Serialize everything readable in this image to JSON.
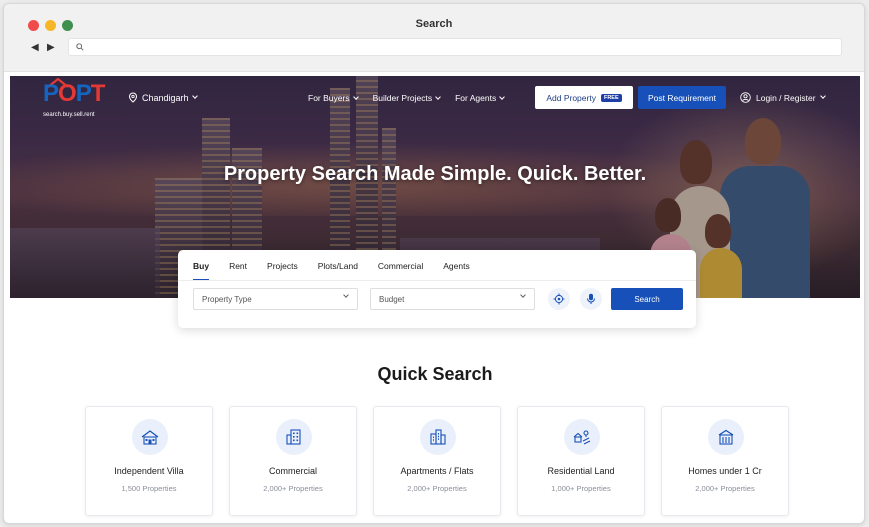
{
  "window": {
    "title": "Search"
  },
  "brand": {
    "logo_letters": [
      "P",
      "O",
      "P",
      "T"
    ],
    "tagline": "search.buy.sell.rent",
    "primary": "#1650b8",
    "accent": "#e53935"
  },
  "header": {
    "city": "Chandigarh",
    "nav": [
      {
        "label": "For Buyers"
      },
      {
        "label": "Builder Projects"
      },
      {
        "label": "For Agents"
      }
    ],
    "add_property": {
      "label": "Add Property",
      "badge": "FREE"
    },
    "post_requirement": "Post Requirement",
    "login": "Login / Register"
  },
  "hero": {
    "title": "Property Search Made Simple. Quick. Better."
  },
  "search": {
    "tabs": [
      "Buy",
      "Rent",
      "Projects",
      "Plots/Land",
      "Commercial",
      "Agents"
    ],
    "active_tab": "Buy",
    "property_type": "Property Type",
    "budget": "Budget",
    "button": "Search"
  },
  "quick_search": {
    "title": "Quick Search",
    "items": [
      {
        "label": "Independent Villa",
        "count": "1,500 Properties",
        "icon": "villa-icon"
      },
      {
        "label": "Commercial",
        "count": "2,000+ Properties",
        "icon": "commercial-building-icon"
      },
      {
        "label": "Apartments / Flats",
        "count": "2,000+ Properties",
        "icon": "apartment-icon"
      },
      {
        "label": "Residential Land",
        "count": "1,000+ Properties",
        "icon": "land-icon"
      },
      {
        "label": "Homes under 1 Cr",
        "count": "2,000+ Properties",
        "icon": "home-budget-icon"
      }
    ]
  }
}
